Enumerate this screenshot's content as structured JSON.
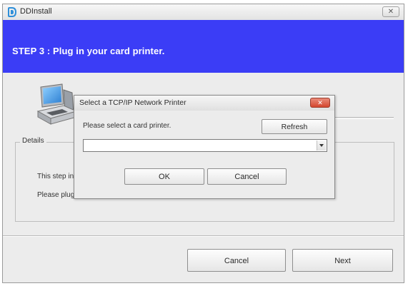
{
  "window": {
    "title": "DDInstall",
    "close_glyph": "✕"
  },
  "banner": {
    "text": "STEP 3 :  Plug in your card printer."
  },
  "details": {
    "label": "Details",
    "line1": "This step in",
    "line2": "Please plug"
  },
  "buttons": {
    "cancel": "Cancel",
    "next": "Next"
  },
  "dialog": {
    "title": "Select a TCP/IP Network Printer",
    "close_glyph": "✕",
    "prompt": "Please select a card printer.",
    "refresh": "Refresh",
    "combo_value": "",
    "ok": "OK",
    "cancel": "Cancel"
  },
  "colors": {
    "banner": "#3b3df6",
    "dialog_close": "#d3462e"
  },
  "icons": {
    "app": "app-logo-icon",
    "printer": "card-printer-icon"
  }
}
